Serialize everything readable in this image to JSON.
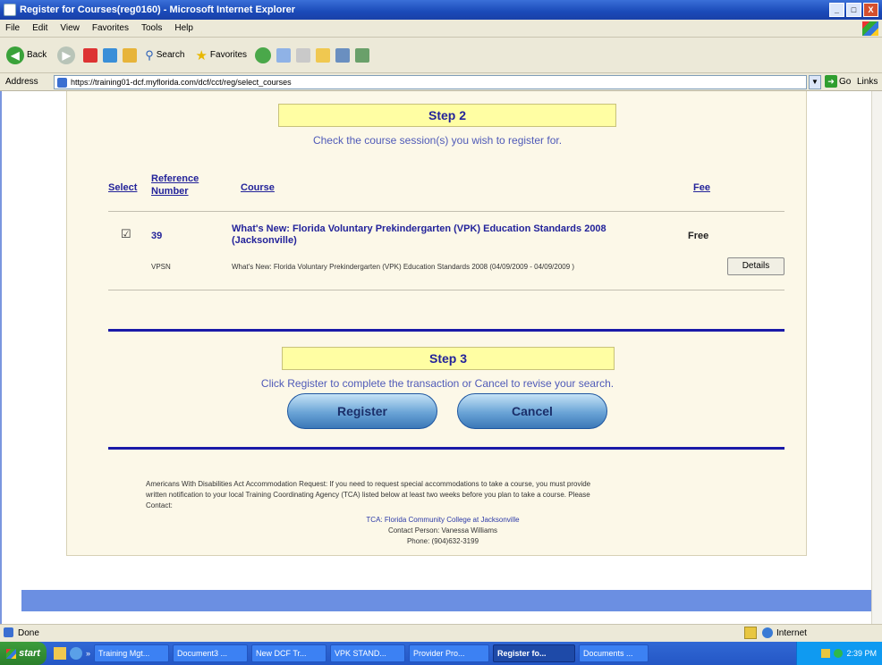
{
  "window": {
    "title": "Register for Courses(reg0160) - Microsoft Internet Explorer",
    "controls": [
      "_",
      "□",
      "X"
    ]
  },
  "menu": [
    "File",
    "Edit",
    "View",
    "Favorites",
    "Tools",
    "Help"
  ],
  "toolbar": {
    "back": "Back",
    "search": "Search",
    "favorites": "Favorites"
  },
  "address": {
    "label": "Address",
    "url": "https://training01-dcf.myflorida.com/dcf/cct/reg/select_courses",
    "go": "Go",
    "links": "Links"
  },
  "step2": {
    "title": "Step 2",
    "instruction": "Check the course session(s) you wish to register for.",
    "headers": {
      "select": "Select",
      "ref_line1": "Reference",
      "ref_line2": "Number",
      "course": "Course",
      "fee": "Fee"
    },
    "course": {
      "checked": "☑",
      "ref": "39",
      "title_line1": "What's New: Florida Voluntary Prekindergarten (VPK) Education Standards 2008",
      "title_line2": "(Jacksonville)",
      "fee": "Free",
      "code": "VPSN",
      "desc": "What's New: Florida Voluntary Prekindergarten (VPK) Education Standards 2008  (04/09/2009 - 04/09/2009 )",
      "details": "Details"
    }
  },
  "step3": {
    "title": "Step 3",
    "instruction": "Click Register to complete the transaction or Cancel to revise your search.",
    "register": "Register",
    "cancel": "Cancel"
  },
  "footer": {
    "ada_line1": "Americans With Disabilities Act Accommodation Request: If you need to request special accommodations to take a course, you must provide",
    "ada_line2": "written notification to your local Training Coordinating Agency (TCA) listed below at least two weeks before you plan to take a course. Please",
    "ada_line3": "Contact:",
    "tca": "TCA: Florida Community College at Jacksonville",
    "contact": "Contact Person: Vanessa Williams",
    "phone": "Phone: (904)632-3199"
  },
  "status": {
    "left": "Done",
    "zone": "Internet"
  },
  "taskbar": {
    "start": "start",
    "tasks": [
      "Training Mgt...",
      "Document3 ...",
      "New DCF Tr...",
      "VPK STAND...",
      "Provider Pro...",
      "Register fo...",
      "Documents ..."
    ],
    "clock": "2:39 PM"
  }
}
